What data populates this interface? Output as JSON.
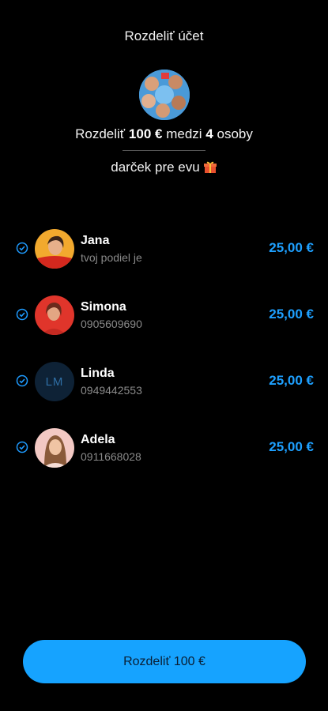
{
  "header": {
    "title": "Rozdeliť účet"
  },
  "summary": {
    "prefix": "Rozdeliť",
    "amount": "100 €",
    "middle": "medzi",
    "count": "4",
    "suffix": "osoby",
    "note": "darček pre evu",
    "note_icon": "gift-icon"
  },
  "people": [
    {
      "name": "Jana",
      "subtitle": "tvoj podiel je",
      "amount": "25,00 €",
      "avatar": "photo"
    },
    {
      "name": "Simona",
      "subtitle": "0905609690",
      "amount": "25,00 €",
      "avatar": "photo"
    },
    {
      "name": "Linda",
      "subtitle": "0949442553",
      "amount": "25,00 €",
      "avatar": "initials",
      "initials": "LM"
    },
    {
      "name": "Adela",
      "subtitle": "0911668028",
      "amount": "25,00 €",
      "avatar": "photo"
    }
  ],
  "footer": {
    "button_label": "Rozdeliť 100 €"
  },
  "colors": {
    "accent": "#16a3ff",
    "amount": "#1ea0ff",
    "background": "#000000",
    "muted": "#8a8a8a"
  }
}
